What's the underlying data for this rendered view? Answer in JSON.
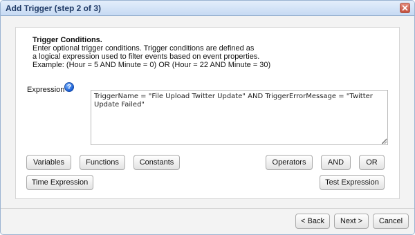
{
  "dialog": {
    "title": "Add Trigger (step 2 of 3)",
    "close_icon": "close-icon"
  },
  "conditions": {
    "heading": "Trigger Conditions.",
    "line1": "Enter optional trigger conditions. Trigger conditions are defined as",
    "line2": "a logical expression used to filter events based on event properties.",
    "example": "Example: (Hour = 5 AND Minute = 0) OR (Hour = 22 AND Minute = 30)"
  },
  "expression": {
    "label": "Expression",
    "help_icon": "help-icon",
    "help_glyph": "?",
    "value": "TriggerName = \"File Upload Twitter Update\" AND TriggerErrorMessage = \"Twitter Update Failed\""
  },
  "buttons": {
    "variables": "Variables",
    "functions": "Functions",
    "constants": "Constants",
    "operators": "Operators",
    "and": "AND",
    "or": "OR",
    "time_expression": "Time Expression",
    "test_expression": "Test Expression"
  },
  "footer": {
    "back": "< Back",
    "next": "Next >",
    "cancel": "Cancel"
  },
  "colors": {
    "titlebar": "#c6daf3",
    "title_text": "#1f3a66",
    "close": "#c34f3d"
  }
}
